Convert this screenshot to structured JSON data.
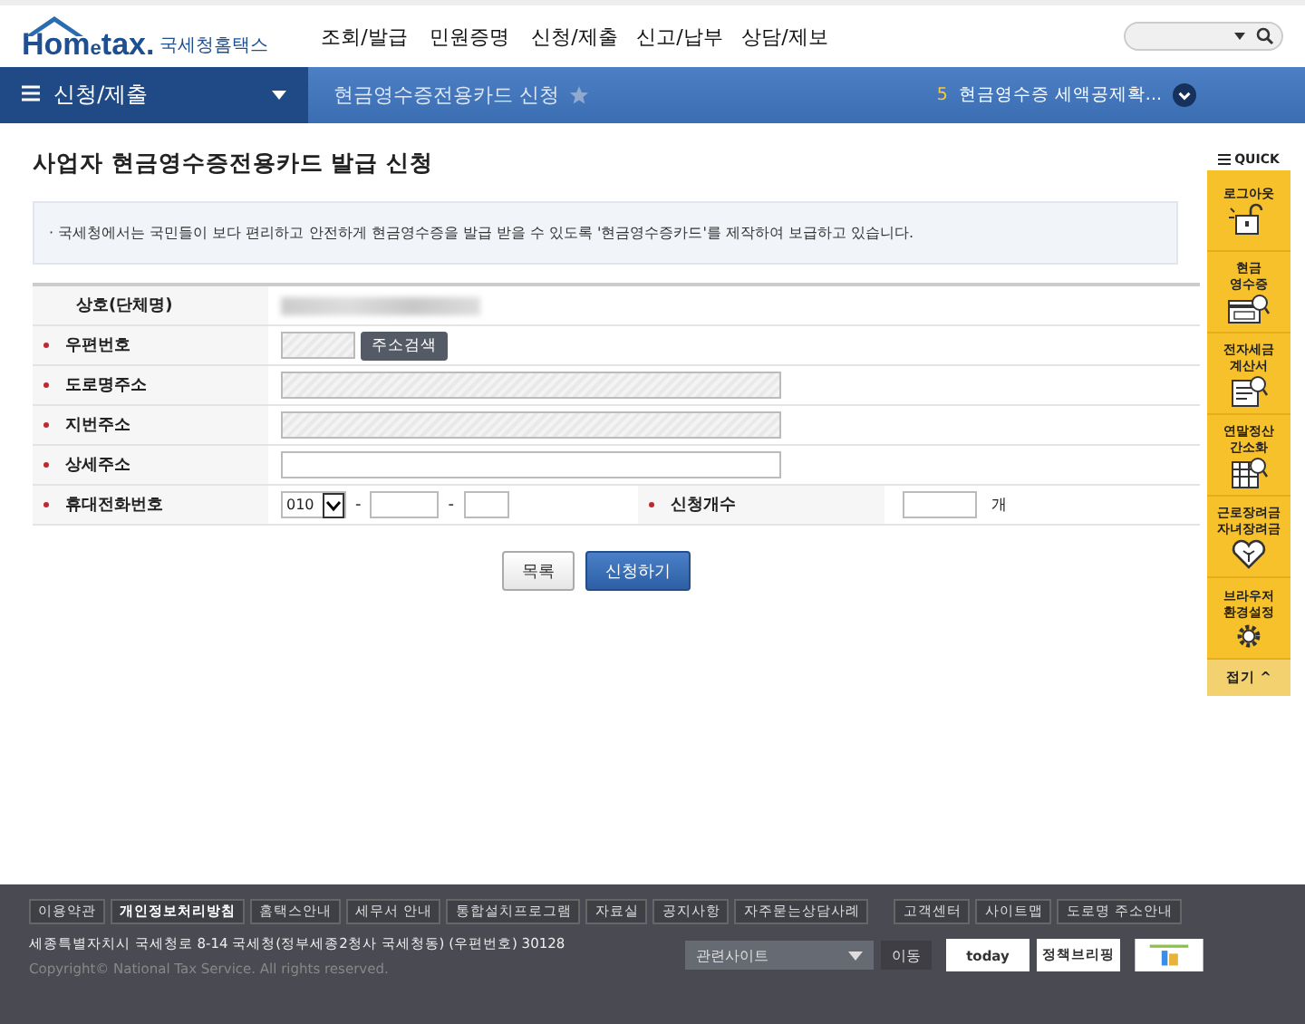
{
  "header": {
    "logo": {
      "main": "Hom",
      "mid": "e",
      "end": "tax.",
      "sub": "국세청홈택스"
    },
    "menu": [
      "조회/발급",
      "민원증명",
      "신청/제출",
      "신고/납부",
      "상담/제보"
    ]
  },
  "navbar": {
    "section": "신청/제출",
    "breadcrumb": "현금영수증전용카드 신청",
    "recent_count": "5",
    "recent": "현금영수증 세액공제확..."
  },
  "page": {
    "title": "사업자 현금영수증전용카드 발급 신청",
    "notice": "· 국세청에서는 국민들이 보다 편리하고 안전하게 현금영수증을 발급 받을 수 있도록 '현금영수증카드'를 제작하여 보급하고 있습니다.",
    "form": [
      {
        "label": "상호(단체명)",
        "required": false,
        "kind": "redacted"
      },
      {
        "label": "우편번호",
        "required": true,
        "kind": "zip",
        "button": "주소검색"
      },
      {
        "label": "도로명주소",
        "required": true,
        "kind": "readonly"
      },
      {
        "label": "지번주소",
        "required": true,
        "kind": "readonly"
      },
      {
        "label": "상세주소",
        "required": true,
        "kind": "input"
      },
      {
        "label": "휴대전화번호",
        "required": true,
        "kind": "phone",
        "prefix": "010",
        "sep": "-",
        "label2": "신청개수",
        "unit": "개"
      }
    ],
    "buttons": [
      {
        "label": "목록",
        "primary": false
      },
      {
        "label": "신청하기",
        "primary": true
      }
    ]
  },
  "quick": {
    "title": "QUICK",
    "items": [
      {
        "lines": [
          "로그아웃"
        ],
        "kind": "lock"
      },
      {
        "lines": [
          "현금",
          "영수증"
        ],
        "kind": "receipt"
      },
      {
        "lines": [
          "전자세금",
          "계산서"
        ],
        "kind": "invoice"
      },
      {
        "lines": [
          "연말정산",
          "간소화"
        ],
        "kind": "sheet"
      },
      {
        "lines": [
          "근로장려금",
          "자녀장려금"
        ],
        "kind": "heart"
      },
      {
        "lines": [
          "브라우저",
          "환경설정"
        ],
        "kind": "gear"
      }
    ],
    "fold": "접기 ^"
  },
  "footer": {
    "links": [
      {
        "label": "이용약관",
        "bold": false
      },
      {
        "label": "개인정보처리방침",
        "bold": true
      },
      {
        "label": "홈택스안내",
        "bold": false
      },
      {
        "label": "세무서 안내",
        "bold": false
      },
      {
        "label": "통합설치프로그램",
        "bold": false
      },
      {
        "label": "자료실",
        "bold": false
      },
      {
        "label": "공지사항",
        "bold": false
      },
      {
        "label": "자주묻는상담사례",
        "bold": false
      }
    ],
    "links2": [
      "고객센터",
      "사이트맵",
      "도로명 주소안내"
    ],
    "address": "세종특별자치시 국세청로 8-14 국세청(정부세종2청사 국세청동) (우편번호) 30128",
    "copyright": "Copyright© National Tax Service. All rights reserved.",
    "related": "관련사이트",
    "go": "이동",
    "banners": [
      "today",
      "정책브리핑"
    ]
  }
}
